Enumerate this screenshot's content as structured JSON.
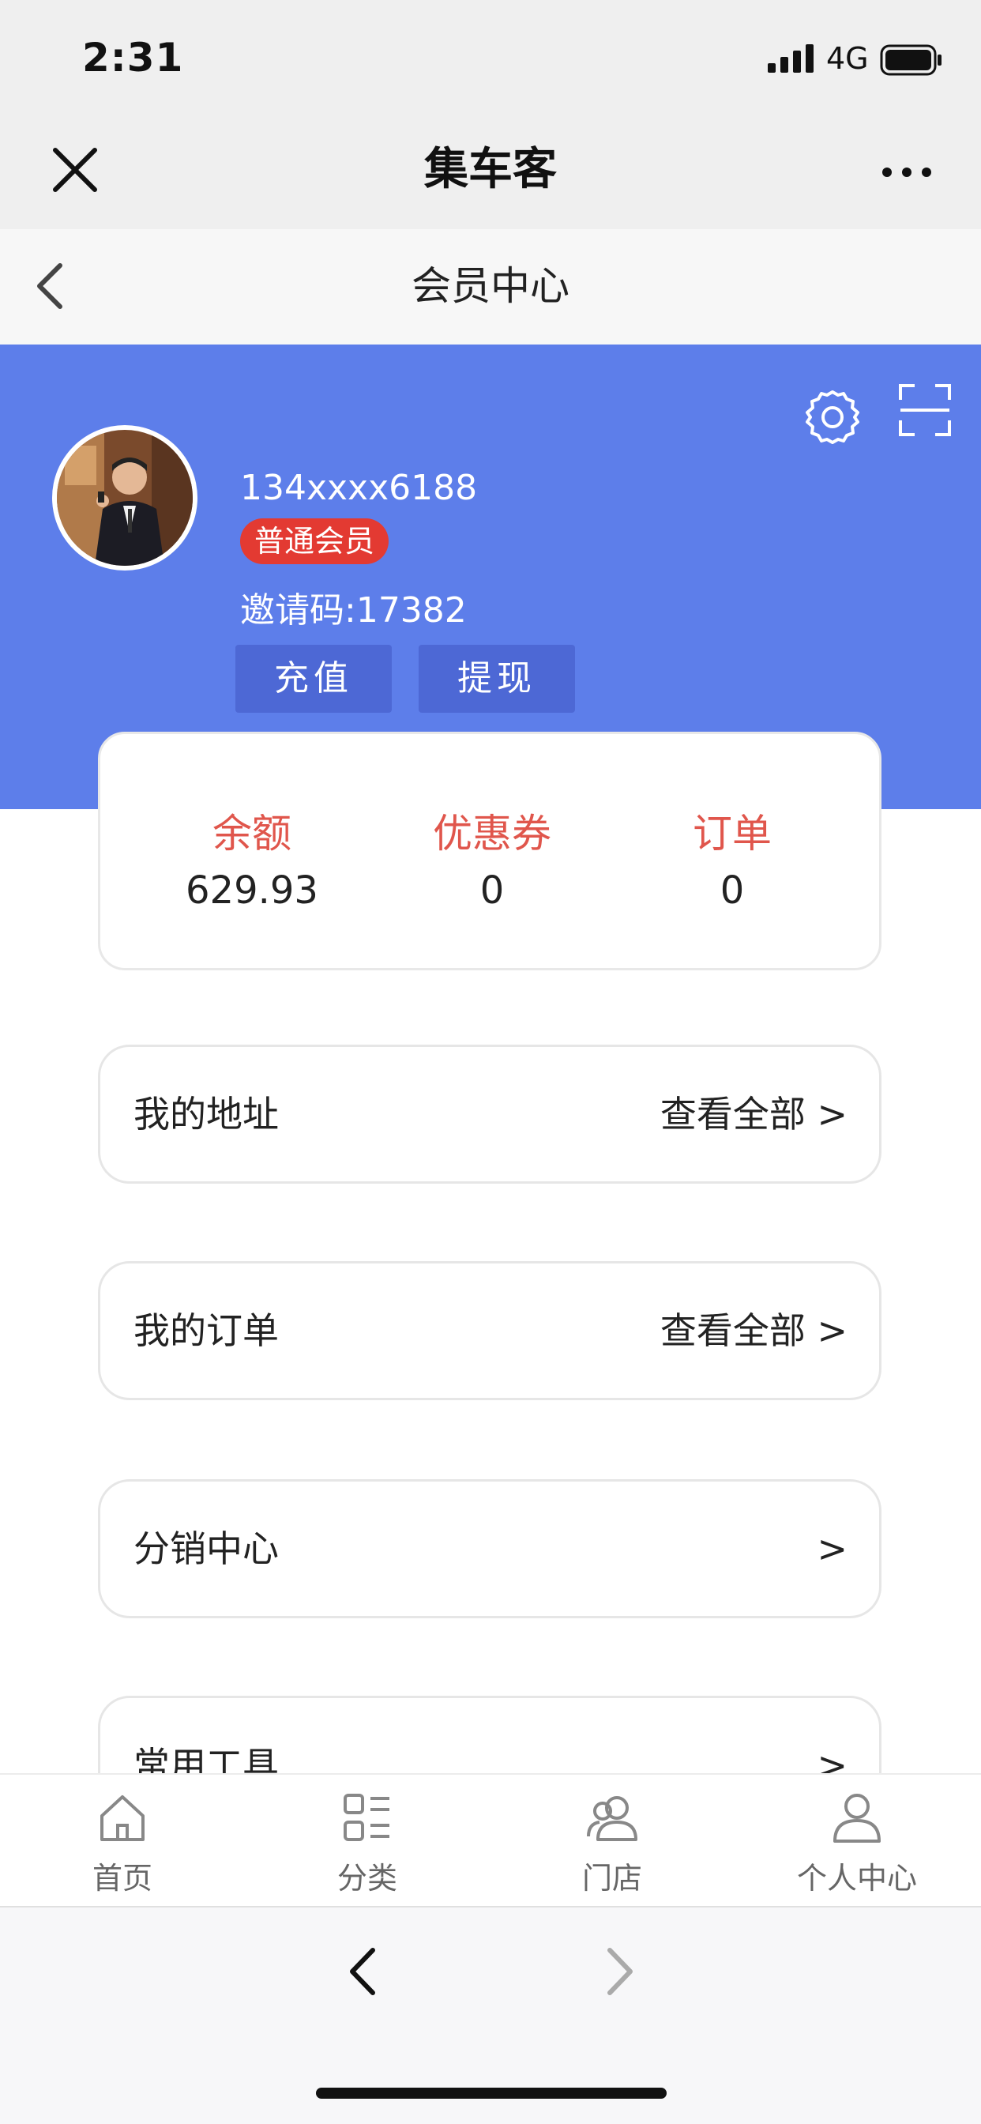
{
  "status_bar": {
    "time": "2:31",
    "network": "4G"
  },
  "title_bar": {
    "title": "集车客",
    "close_icon": "close-icon",
    "more_icon": "more-icon"
  },
  "page_header": {
    "title": "会员中心",
    "back_icon": "chevron-left-icon"
  },
  "profile": {
    "phone": "134xxxx6188",
    "level_badge": "普通会员",
    "invite_code": "邀请码:17382",
    "recharge_label": "充值",
    "withdraw_label": "提现",
    "hero_color": "#5d7eea",
    "badge_color": "#e33a32"
  },
  "stats": [
    {
      "label": "余额",
      "value": "629.93"
    },
    {
      "label": "优惠券",
      "value": "0"
    },
    {
      "label": "订单",
      "value": "0"
    }
  ],
  "menu": [
    {
      "label": "我的地址",
      "right": "查看全部 >"
    },
    {
      "label": "我的订单",
      "right": "查看全部 >"
    },
    {
      "label": "分销中心",
      "right": ">"
    },
    {
      "label": "常用工具",
      "right": ">"
    }
  ],
  "tabs": [
    {
      "label": "首页",
      "icon": "home-icon"
    },
    {
      "label": "分类",
      "icon": "category-icon"
    },
    {
      "label": "门店",
      "icon": "store-icon"
    },
    {
      "label": "个人中心",
      "icon": "profile-icon"
    }
  ]
}
